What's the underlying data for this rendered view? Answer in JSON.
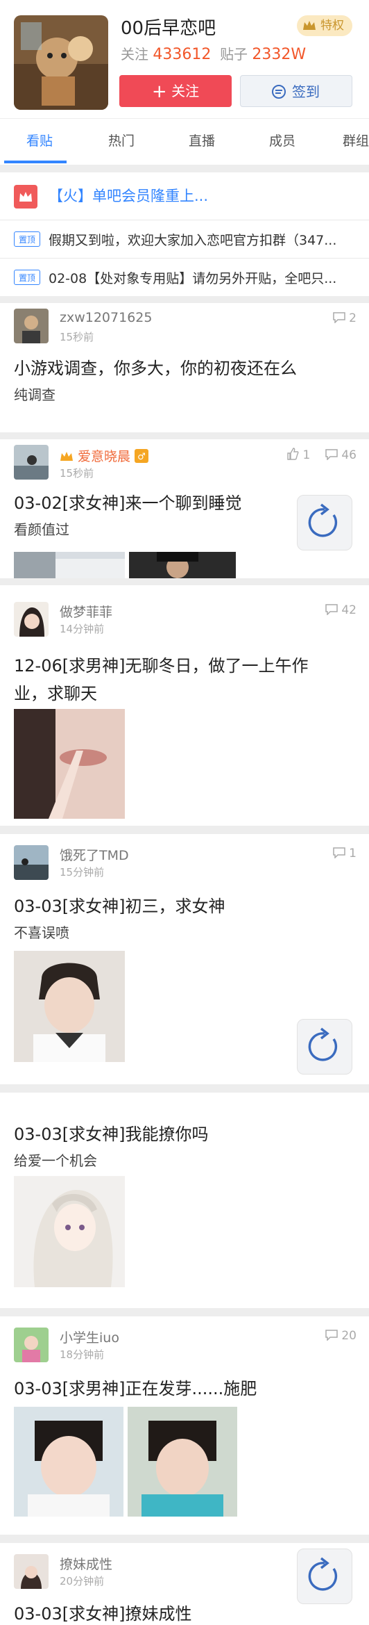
{
  "forum": {
    "name": "00后早恋吧",
    "follow_label": "关注",
    "followers": "433612",
    "posts_label": "贴子",
    "posts": "2332W",
    "vip_label": "特权",
    "follow_button": "关注",
    "sign_button": "签到"
  },
  "tabs": [
    "看贴",
    "热门",
    "直播",
    "成员",
    "群组"
  ],
  "notice": {
    "headline": "【火】单吧会员隆重上...",
    "pinned": [
      {
        "tag": "置顶",
        "text": "假期又到啦，欢迎大家加入恋吧官方扣群（347..."
      },
      {
        "tag": "置顶",
        "text": "02-08【处对象专用贴】请勿另外开贴，全吧只..."
      }
    ]
  },
  "posts": [
    {
      "author": "zxw12071625",
      "time": "15秒前",
      "comments": "2",
      "title": "小游戏调查，你多大，你的初夜还在么",
      "desc": "纯调查"
    },
    {
      "author": "爱意晓晨",
      "time": "15秒前",
      "likes": "1",
      "comments": "46",
      "title": "03-02[求女神]来一个聊到睡觉",
      "desc": "看颜值过"
    },
    {
      "author": "做梦菲菲",
      "time": "14分钟前",
      "comments": "42",
      "title": "12-06[求男神]无聊冬日，做了一上午作",
      "title2": "业，求聊天",
      "desc": ""
    },
    {
      "author": "饿死了TMD",
      "time": "15分钟前",
      "comments": "1",
      "title": "03-03[求女神]初三，求女神",
      "desc": "不喜误喷"
    },
    {
      "author": "",
      "time": "",
      "comments": "",
      "title": "03-03[求女神]我能撩你吗",
      "desc": "给爱一个机会"
    },
    {
      "author": "小学生iuo",
      "time": "18分钟前",
      "comments": "20",
      "title": "03-03[求男神]正在发芽......施肥",
      "desc": ""
    },
    {
      "author": "撩妹成性",
      "time": "20分钟前",
      "comments": "",
      "title": "03-03[求女神]撩妹成性",
      "desc": ""
    }
  ],
  "colors": {
    "accent": "#3385ff",
    "follow": "#f04a56",
    "vip": "#f06a3a"
  }
}
